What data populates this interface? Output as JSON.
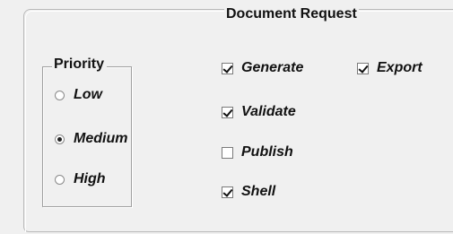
{
  "group": {
    "title": "Document Request"
  },
  "priority": {
    "title": "Priority",
    "options": [
      {
        "label": "Low",
        "selected": false
      },
      {
        "label": "Medium",
        "selected": true
      },
      {
        "label": "High",
        "selected": false
      }
    ]
  },
  "actions": {
    "generate": {
      "label": "Generate",
      "checked": true
    },
    "export": {
      "label": "Export",
      "checked": true
    },
    "validate": {
      "label": "Validate",
      "checked": true
    },
    "publish": {
      "label": "Publish",
      "checked": false
    },
    "shell": {
      "label": "Shell",
      "checked": true
    }
  }
}
